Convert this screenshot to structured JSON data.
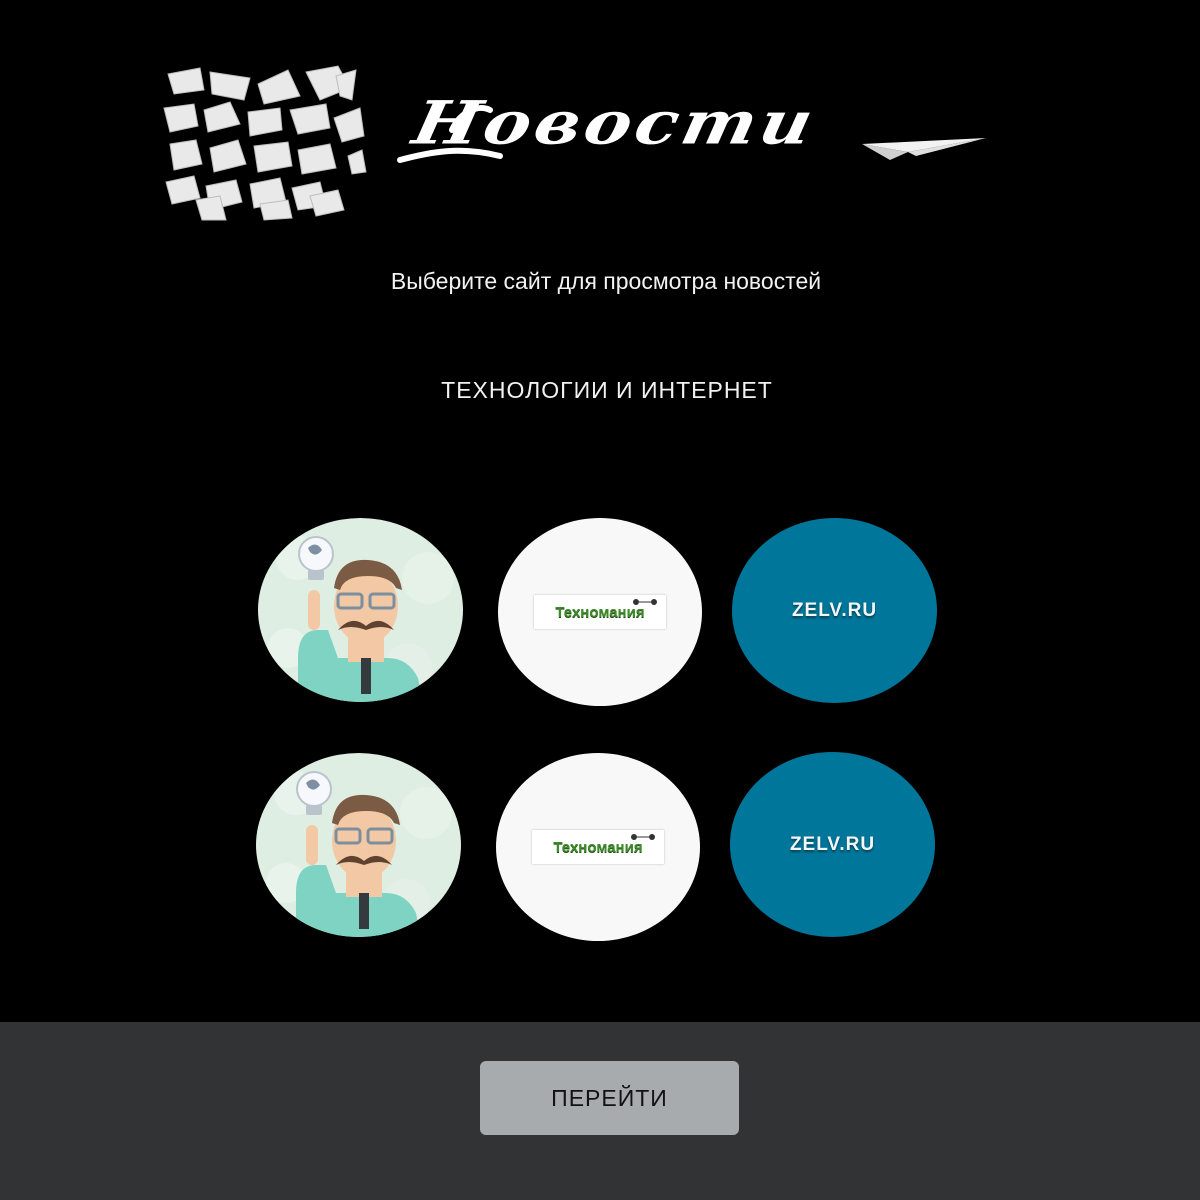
{
  "header": {
    "logo_text": "Новости",
    "logo_icons": [
      "shredded-paper-icon",
      "paper-plane-icon"
    ]
  },
  "subtitle": "Выберите сайт для просмотра новостей",
  "category": "ТЕХНОЛОГИИ И ИНТЕРНЕТ",
  "sites": {
    "idea_image": "idea-man-illustration",
    "technomania_label": "Техномания",
    "zelv_label": "ZELV.RU"
  },
  "footer": {
    "go_label": "ПЕРЕЙТИ"
  },
  "colors": {
    "background": "#000000",
    "footer": "#323335",
    "button": "#a8abae",
    "zelv": "#00769a",
    "technomania_green": "#3f8a2b"
  }
}
